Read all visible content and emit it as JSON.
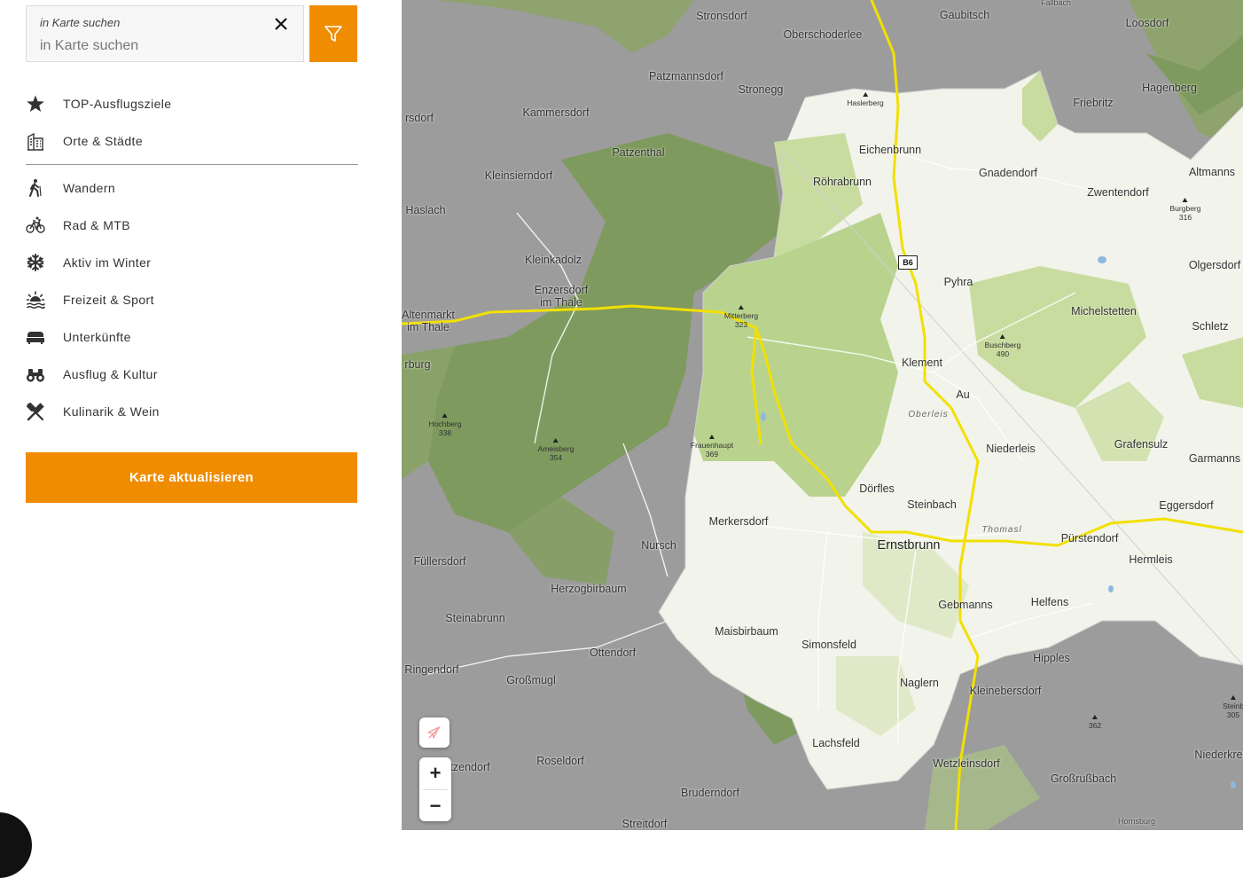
{
  "search": {
    "label": "in Karte suchen",
    "placeholder": "in Karte suchen",
    "value": ""
  },
  "menu_top": [
    {
      "label": "TOP-Ausflugsziele",
      "icon": "star-icon"
    },
    {
      "label": "Orte & Städte",
      "icon": "building-icon"
    }
  ],
  "menu_categories": [
    {
      "label": "Wandern",
      "icon": "hiker-icon"
    },
    {
      "label": "Rad & MTB",
      "icon": "bicycle-icon"
    },
    {
      "label": "Aktiv im Winter",
      "icon": "snowflake-icon"
    },
    {
      "label": "Freizeit & Sport",
      "icon": "sun-water-icon"
    },
    {
      "label": "Unterkünfte",
      "icon": "bed-icon"
    },
    {
      "label": "Ausflug & Kultur",
      "icon": "binoculars-icon"
    },
    {
      "label": "Kulinarik & Wein",
      "icon": "cutlery-icon"
    }
  ],
  "update_button": "Karte aktualisieren",
  "colors": {
    "accent": "#f08c00",
    "map_outside": "#9a9a9a",
    "map_region": "#f2f3ea",
    "forest_light": "#c8dca0",
    "forest_dark": "#7f9a5e",
    "road_major": "#f2e000"
  },
  "map": {
    "places": [
      "Stronsdorf",
      "Gaubitsch",
      "Loosdorf",
      "Oberschoderlee",
      "Patzmannsdorf",
      "Stronegg",
      "Hagenberg",
      "Friebritz",
      "Kammersdorf",
      "Patzenthal",
      "Eichenbrunn",
      "Altmanns",
      "Kleinsierndorf",
      "Röhrabrunn",
      "Gnadendorf",
      "Zwentendorf",
      "Haslach",
      "Olgersdorf",
      "Kleinkadolz",
      "Pyhra",
      "Enzersdorf im Thale",
      "Michelstetten",
      "Altenmarkt im Thale",
      "Schletz",
      "Klement",
      "Au",
      "Grafensulz",
      "Niederleis",
      "Garmanns",
      "Dörfles",
      "Steinbach",
      "Merkersdorf",
      "Eggersdorf",
      "Ernstbrunn",
      "Pürstendorf",
      "Nursch",
      "Hermleis",
      "Füllersdorf",
      "Herzogbirbaum",
      "Gebmanns",
      "Helfens",
      "Steinabrunn",
      "Maisbirbaum",
      "Simonsfeld",
      "Ottendorf",
      "Hipples",
      "Ringendorf",
      "Großmugl",
      "Naglern",
      "Kleinebersdorf",
      "Lachsfeld",
      "Roseldorf",
      "Wetzleinsdorf",
      "Großrußbach",
      "Bruderndorf",
      "Niederkreu",
      "Streitdorf",
      "Hornsburg",
      "rsdorf",
      "rburg",
      "tzendorf",
      "Fallbach"
    ],
    "localities": [
      "Oberleis",
      "Thomasl"
    ],
    "peaks": [
      {
        "name": "Haslerberg",
        "elevation": ""
      },
      {
        "name": "Burgberg",
        "elevation": "316"
      },
      {
        "name": "Mitterberg",
        "elevation": "323"
      },
      {
        "name": "Buschberg",
        "elevation": "490"
      },
      {
        "name": "Hochberg",
        "elevation": "338"
      },
      {
        "name": "Ameisberg",
        "elevation": "354"
      },
      {
        "name": "Frauenhaupt",
        "elevation": "369"
      },
      {
        "name": "",
        "elevation": "362"
      },
      {
        "name": "Steinb",
        "elevation": "305"
      }
    ],
    "road_shield": "B6"
  },
  "zoom": {
    "in": "+",
    "out": "−"
  }
}
